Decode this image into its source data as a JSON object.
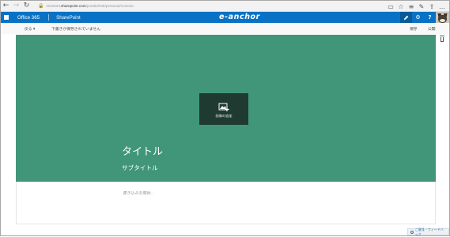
{
  "browser": {
    "url_prefix": "newstart",
    "url_domain": ".sharepoint.com",
    "url_path": "/portals/hub/personal/contoso"
  },
  "suite": {
    "app_name": "Office 365",
    "site_name": "SharePoint",
    "brand_logo": "e-anchor",
    "settings_label": "⚙",
    "help_label": "?"
  },
  "command": {
    "back_label": "戻る ▾",
    "status": "下書きが保存されていません",
    "save_label": "保存",
    "publish_label": "公開"
  },
  "hero": {
    "add_image_label": "画像の追加",
    "title": "タイトル",
    "subtitle": "サブタイトル"
  },
  "body": {
    "placeholder": "書き込みを開始..."
  },
  "footer": {
    "feedback_label": "ご意見・フィードバック"
  },
  "colors": {
    "suite_bar": "#0a72c4",
    "hero_background": "#419679",
    "add_image_tile": "#1f3a30"
  },
  "icons": [
    "back-arrow-icon",
    "forward-arrow-icon",
    "refresh-icon",
    "lock-icon",
    "reading-view-icon",
    "favorite-star-icon",
    "hub-icon",
    "notes-icon",
    "share-icon",
    "more-icon",
    "waffle-icon",
    "edit-icon",
    "gear-icon",
    "help-icon",
    "trash-icon",
    "add-image-icon",
    "feedback-icon"
  ]
}
